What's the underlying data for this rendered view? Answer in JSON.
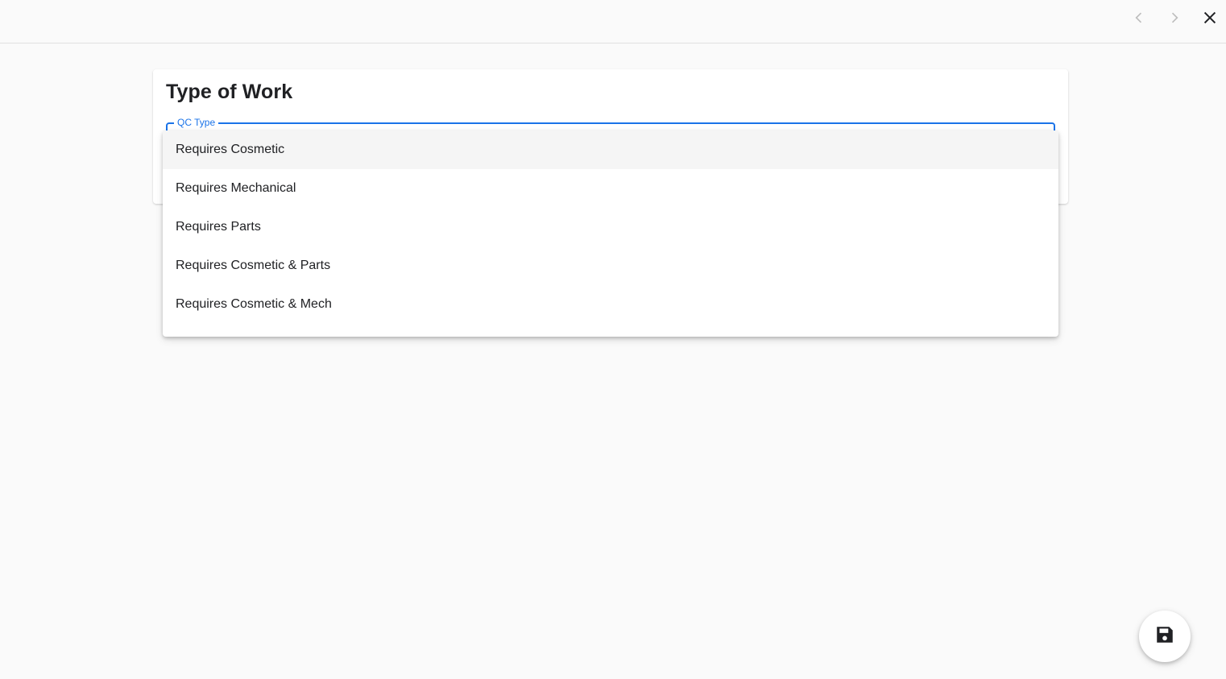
{
  "topbar": {
    "icons": [
      "chevron-left-icon",
      "chevron-right-icon",
      "close-icon"
    ]
  },
  "card": {
    "title": "Type of Work",
    "field_label": "QC Type"
  },
  "dropdown": {
    "options": [
      {
        "label": "Requires Cosmetic"
      },
      {
        "label": "Requires Mechanical"
      },
      {
        "label": "Requires Parts"
      },
      {
        "label": "Requires Cosmetic & Parts"
      },
      {
        "label": "Requires Cosmetic & Mech"
      }
    ]
  },
  "fab": {
    "icon": "save-icon"
  },
  "colors": {
    "accent": "#1a73e8",
    "background": "#fafafa",
    "hover": "#f5f5f5"
  }
}
